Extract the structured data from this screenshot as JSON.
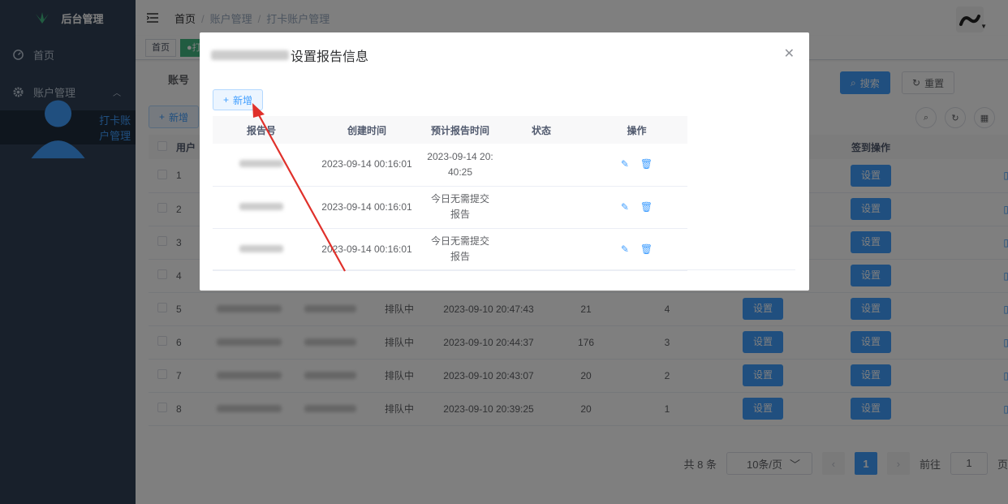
{
  "app": {
    "title": "后台管理"
  },
  "sidebar": {
    "items": [
      {
        "label": "首页",
        "icon": "dashboard-icon"
      },
      {
        "label": "账户管理",
        "icon": "gear-icon"
      },
      {
        "label": "打卡账户管理",
        "icon": "user-icon"
      }
    ]
  },
  "header": {
    "breadcrumb": [
      "首页",
      "账户管理",
      "打卡账户管理"
    ]
  },
  "tags": [
    {
      "label": "首页"
    },
    {
      "label": "●打"
    }
  ],
  "search": {
    "account_label": "账号",
    "search_label": "搜索",
    "reset_label": "重置"
  },
  "toolbar": {
    "add_label": "新增"
  },
  "table": {
    "headers": {
      "id": "用户",
      "sign_op": "签到操作"
    },
    "rows": [
      {
        "id": "1",
        "status": "",
        "time": "",
        "a": "",
        "b": ""
      },
      {
        "id": "2",
        "status": "",
        "time": "",
        "a": "",
        "b": ""
      },
      {
        "id": "3",
        "status": "",
        "time": "",
        "a": "",
        "b": ""
      },
      {
        "id": "4",
        "status": "",
        "time": "",
        "a": "",
        "b": ""
      },
      {
        "id": "5",
        "status": "排队中",
        "time": "2023-09-10 20:47:43",
        "a": "21",
        "b": "4"
      },
      {
        "id": "6",
        "status": "排队中",
        "time": "2023-09-10 20:44:37",
        "a": "176",
        "b": "3"
      },
      {
        "id": "7",
        "status": "排队中",
        "time": "2023-09-10 20:43:07",
        "a": "20",
        "b": "2"
      },
      {
        "id": "8",
        "status": "排队中",
        "time": "2023-09-10 20:39:25",
        "a": "20",
        "b": "1"
      }
    ],
    "set_label": "设置"
  },
  "pagination": {
    "total": "共 8 条",
    "page_size": "10条/页",
    "current": "1",
    "goto_label": "前往",
    "goto_value": "1",
    "page_unit": "页"
  },
  "dialog": {
    "title": "设置报告信息",
    "add_label": "新增",
    "columns": [
      "报告号",
      "创建时间",
      "预计报告时间",
      "状态",
      "操作"
    ],
    "rows": [
      {
        "created": "2023-09-14 00:16:01",
        "expected_line1": "2023-09-14 20:",
        "expected_line2": "40:25",
        "status": ""
      },
      {
        "created": "2023-09-14 00:16:01",
        "expected_line1": "今日无需提交",
        "expected_line2": "报告",
        "status": ""
      },
      {
        "created": "2023-09-14 00:16:01",
        "expected_line1": "今日无需提交",
        "expected_line2": "报告",
        "status": ""
      }
    ]
  },
  "colors": {
    "primary": "#409eff",
    "sidebar": "#304156",
    "annotation_arrow": "#e0302a"
  }
}
